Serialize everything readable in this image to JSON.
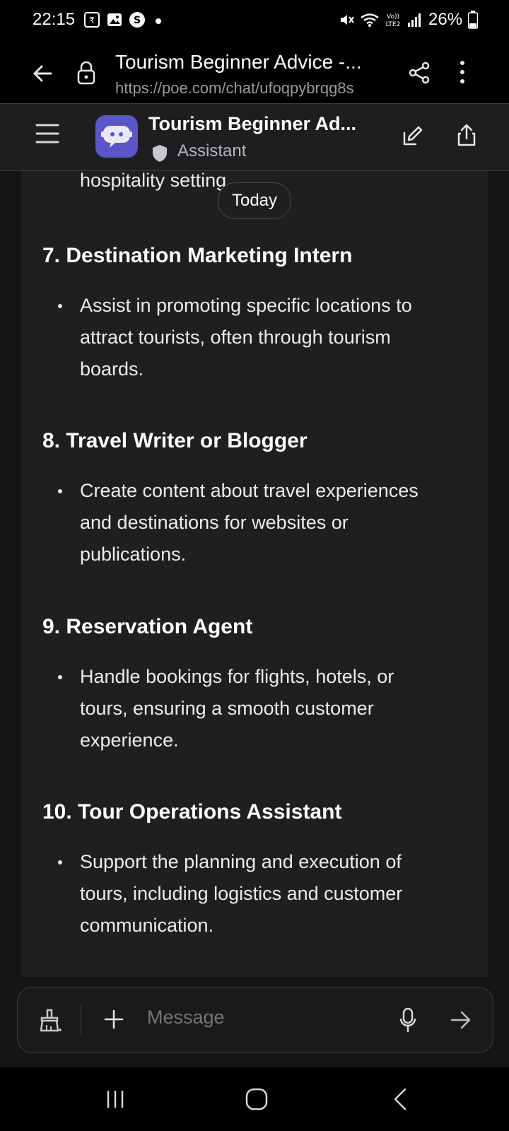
{
  "status_bar": {
    "time": "22:15",
    "battery": "26%"
  },
  "browser": {
    "title": "Tourism Beginner Advice -...",
    "url": "https://poe.com/chat/ufoqpybrqg8s"
  },
  "chat_header": {
    "bot_name": "Tourism Beginner Ad...",
    "subtitle": "Assistant"
  },
  "message": {
    "partial_line": "hospitality setting",
    "date_pill": "Today",
    "items": [
      {
        "heading": "7. Destination Marketing Intern",
        "lines": [
          "Assist in promoting specific locations to",
          "attract tourists, often through tourism",
          "boards."
        ]
      },
      {
        "heading": "8. Travel Writer or Blogger",
        "lines": [
          "Create content about travel experiences",
          "and destinations for websites or",
          "publications."
        ]
      },
      {
        "heading": "9. Reservation Agent",
        "lines": [
          "Handle bookings for flights, hotels, or",
          "tours, ensuring a smooth customer",
          "experience."
        ]
      },
      {
        "heading": "10. Tour Operations Assistant",
        "lines": [
          "Support the planning and execution of",
          "tours, including logistics and customer",
          "communication."
        ]
      }
    ]
  },
  "input": {
    "placeholder": "Message"
  },
  "colors": {
    "background": "#151518",
    "card": "#1f1f22",
    "bot_avatar": "#5b55c7"
  }
}
